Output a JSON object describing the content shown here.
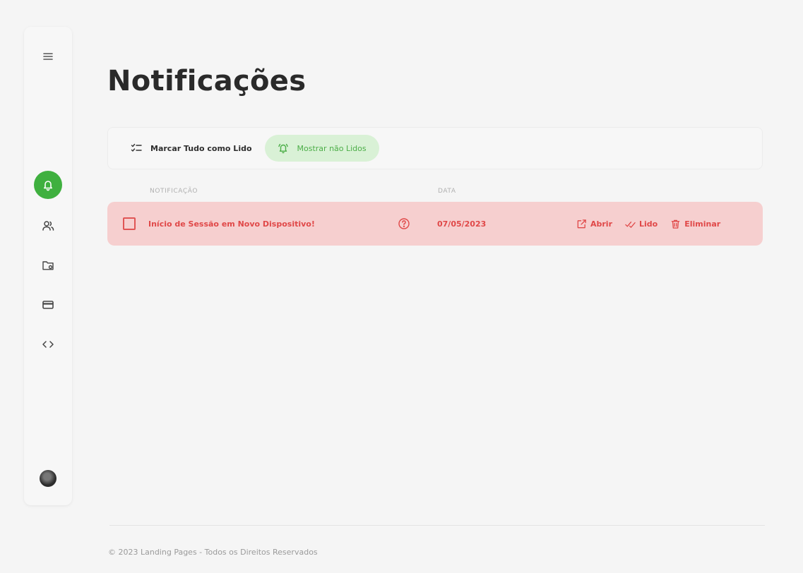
{
  "page": {
    "title": "Notificações"
  },
  "sidebar": {
    "items": [
      {
        "name": "menu",
        "icon": "hamburger-icon"
      },
      {
        "name": "notifications",
        "icon": "bell-icon",
        "active": true
      },
      {
        "name": "users",
        "icon": "users-icon"
      },
      {
        "name": "folder",
        "icon": "folder-settings-icon"
      },
      {
        "name": "billing",
        "icon": "credit-card-icon"
      },
      {
        "name": "code",
        "icon": "code-icon"
      }
    ],
    "avatar": {
      "icon": "user-avatar"
    },
    "accent_color": "#3fb03f"
  },
  "toolbar": {
    "mark_all_read": {
      "label": "Marcar Tudo como Lido",
      "icon": "checklist-icon"
    },
    "show_unread": {
      "label": "Mostrar não Lidos",
      "icon": "bell-ring-icon",
      "color": "#4cae48",
      "bg": "#d9f1d6"
    }
  },
  "table": {
    "headers": {
      "notification": "NOTIFICAÇÃO",
      "date": "DATA"
    },
    "rows": [
      {
        "text": "Início de Sessão em Novo Dispositivo!",
        "date": "07/05/2023",
        "info_icon": "help-circle-icon",
        "actions": {
          "open": "Abrir",
          "read": "Lido",
          "delete": "Eliminar"
        },
        "color": "#e04848",
        "bg": "#f6cfcf"
      }
    ]
  },
  "footer": {
    "text": "© 2023 Landing Pages - Todos os Direitos Reservados"
  }
}
